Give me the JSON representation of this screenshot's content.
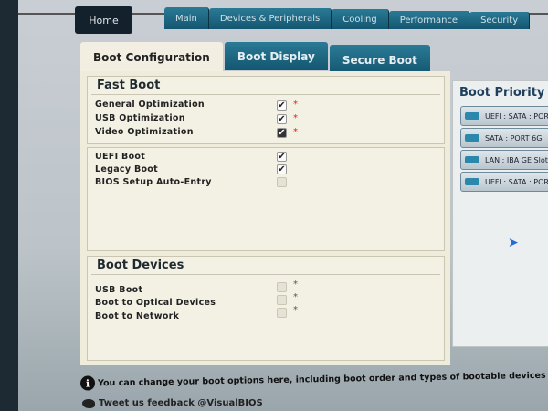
{
  "top_nav": {
    "home": "Home",
    "tabs": [
      "Main",
      "Devices & Peripherals",
      "Cooling",
      "Performance",
      "Security"
    ]
  },
  "sub_tabs": [
    "Boot Configuration",
    "Boot Display",
    "Secure Boot"
  ],
  "fast_boot": {
    "title": "Fast Boot",
    "items": [
      {
        "label": "General Optimization",
        "checked": true,
        "marker": "*"
      },
      {
        "label": "USB Optimization",
        "checked": true,
        "marker": "*"
      },
      {
        "label": "Video Optimization",
        "checked": true,
        "marker": "*"
      }
    ]
  },
  "boot_mode": {
    "items": [
      {
        "label": "UEFI Boot",
        "checked": true
      },
      {
        "label": "Legacy Boot",
        "checked": true
      },
      {
        "label": "BIOS Setup Auto-Entry",
        "checked": false
      }
    ]
  },
  "boot_devices": {
    "title": "Boot Devices",
    "items": [
      {
        "label": "USB Boot",
        "checked": false,
        "marker": "*"
      },
      {
        "label": "Boot to Optical Devices",
        "checked": false,
        "marker": "*"
      },
      {
        "label": "Boot to Network",
        "checked": false,
        "marker": "*"
      }
    ]
  },
  "boot_priority": {
    "title": "Boot Priority",
    "items": [
      "UEFI : SATA : POR",
      "SATA : PORT 6G",
      "LAN : IBA GE Slot",
      "UEFI : SATA : POR"
    ]
  },
  "info_text": "You can change your boot options here, including boot order and types of bootable devices for y",
  "tweet_text": "Tweet us feedback @VisualBIOS",
  "check_glyph": "✔"
}
